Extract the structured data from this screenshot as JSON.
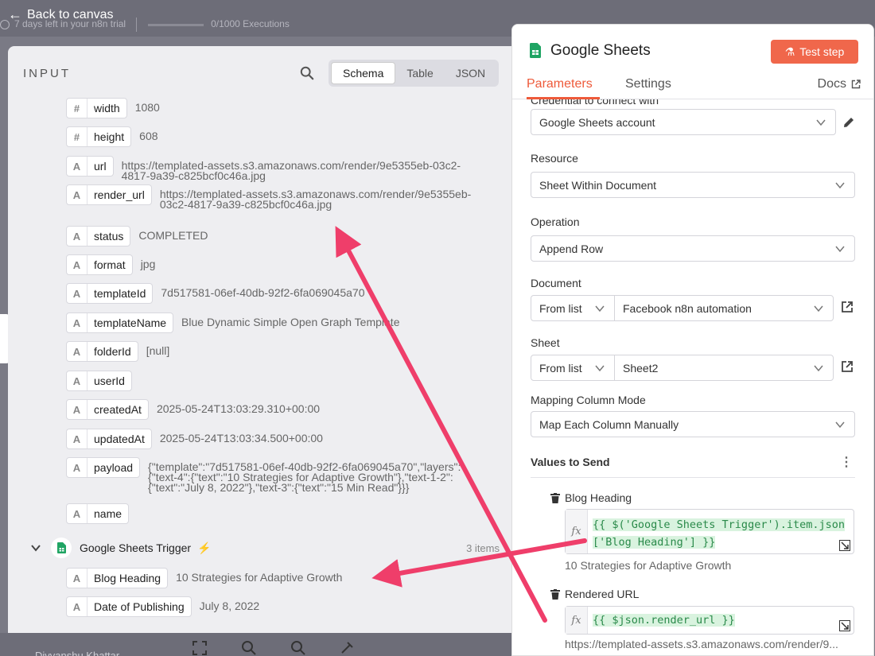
{
  "topbar": {
    "back_label": "Back to canvas",
    "trial_text": "7 days left in your n8n trial",
    "executions": "0/1000 Executions",
    "execution_progress": 0
  },
  "input_panel": {
    "title": "INPUT",
    "tabs": [
      "Schema",
      "Table",
      "JSON"
    ],
    "active_tab": "Schema",
    "fields": [
      {
        "type": "#",
        "key": "width",
        "value": "1080"
      },
      {
        "type": "#",
        "key": "height",
        "value": "608"
      },
      {
        "type": "A",
        "key": "url",
        "value": "https://templated-assets.s3.amazonaws.com/render/9e5355eb-03c2-4817-9a39-c825bcf0c46a.jpg"
      },
      {
        "type": "A",
        "key": "render_url",
        "value": "https://templated-assets.s3.amazonaws.com/render/9e5355eb-03c2-4817-9a39-c825bcf0c46a.jpg"
      },
      {
        "type": "A",
        "key": "status",
        "value": "COMPLETED"
      },
      {
        "type": "A",
        "key": "format",
        "value": "jpg"
      },
      {
        "type": "A",
        "key": "templateId",
        "value": "7d517581-06ef-40db-92f2-6fa069045a70"
      },
      {
        "type": "A",
        "key": "templateName",
        "value": "Blue Dynamic Simple Open Graph Template"
      },
      {
        "type": "A",
        "key": "folderId",
        "value": "[null]"
      },
      {
        "type": "A",
        "key": "userId",
        "value": ""
      },
      {
        "type": "A",
        "key": "createdAt",
        "value": "2025-05-24T13:03:29.310+00:00"
      },
      {
        "type": "A",
        "key": "updatedAt",
        "value": "2025-05-24T13:03:34.500+00:00"
      },
      {
        "type": "A",
        "key": "payload",
        "value": "{\"template\":\"7d517581-06ef-40db-92f2-6fa069045a70\",\"layers\":{\"text-4\":{\"text\":\"10 Strategies for Adaptive Growth\"},\"text-1-2\":{\"text\":\"July 8, 2022\"},\"text-3\":{\"text\":\"15 Min Read\"}}}"
      },
      {
        "type": "A",
        "key": "name",
        "value": ""
      }
    ],
    "trigger_node": {
      "name": "Google Sheets Trigger",
      "items": "3 items",
      "fields": [
        {
          "type": "A",
          "key": "Blog Heading",
          "value": "10 Strategies for Adaptive Growth"
        },
        {
          "type": "A",
          "key": "Date of Publishing",
          "value": "July 8, 2022"
        }
      ]
    }
  },
  "params_panel": {
    "node_title": "Google Sheets",
    "test_button": "Test step",
    "tabs": [
      "Parameters",
      "Settings"
    ],
    "docs_label": "Docs",
    "credential_label": "Credential to connect with",
    "credential_value": "Google Sheets account",
    "resource_label": "Resource",
    "resource_value": "Sheet Within Document",
    "operation_label": "Operation",
    "operation_value": "Append Row",
    "document_label": "Document",
    "document_mode": "From list",
    "document_value": "Facebook n8n automation",
    "sheet_label": "Sheet",
    "sheet_mode": "From list",
    "sheet_value": "Sheet2",
    "mapping_label": "Mapping Column Mode",
    "mapping_value": "Map Each Column Manually",
    "values_label": "Values to Send",
    "values": [
      {
        "name": "Blog Heading",
        "expression": [
          "{{ $('Google Sheets Trigger').item.json",
          "['Blog Heading'] }}"
        ],
        "result": "10 Strategies for Adaptive Growth"
      },
      {
        "name": "Rendered URL",
        "expression": [
          "{{ $json.render_url }}"
        ],
        "result": "https://templated-assets.s3.amazonaws.com/render/9..."
      }
    ]
  },
  "bottom": {
    "user": "Divyanshu Khattar"
  },
  "colors": {
    "accent": "#ee5a3a",
    "annotation_arrow": "#ef3e6a",
    "expression_green": "#2a8a4a"
  }
}
